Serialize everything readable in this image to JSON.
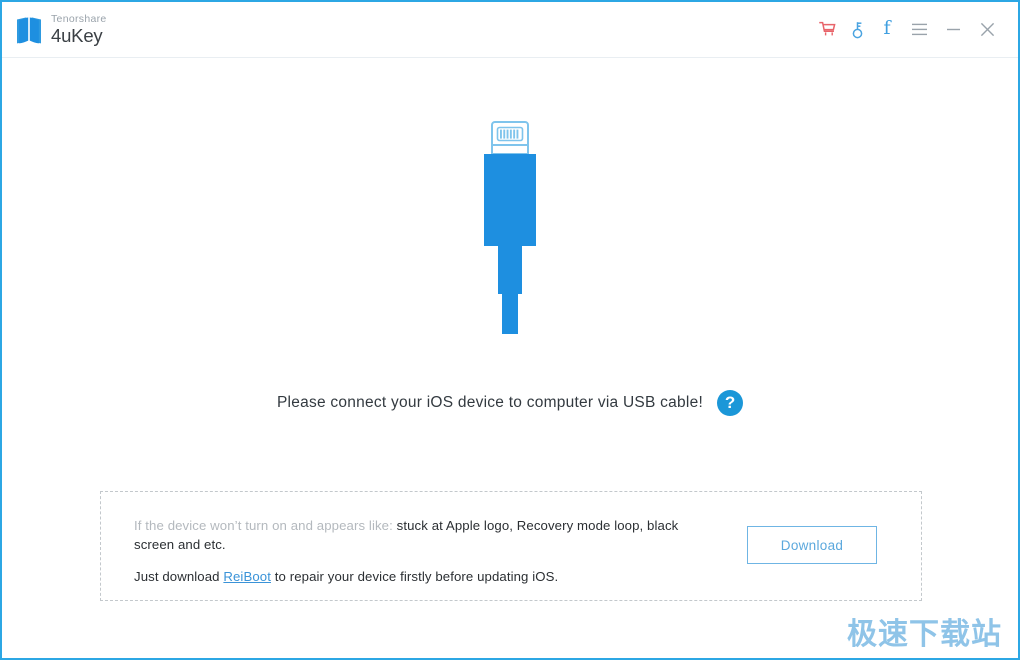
{
  "window": {
    "accent_border_color": "#2ca7e4",
    "background": "#ffffff"
  },
  "titlebar": {
    "brand_top": "Tenorshare",
    "brand_bottom": "4uKey",
    "logo_icon": "shield-book-logo",
    "icons": [
      {
        "name": "cart-icon",
        "label": "Store",
        "color": "#e8646a"
      },
      {
        "name": "key-icon",
        "label": "Register",
        "color": "#4aa3e0"
      },
      {
        "name": "facebook-icon",
        "label": "Facebook",
        "color": "#3f9fe0",
        "glyph": "f"
      },
      {
        "name": "menu-icon",
        "label": "Menu",
        "color": "#9aa3ab"
      },
      {
        "name": "minimize-icon",
        "label": "Minimize",
        "color": "#9aa3ab"
      },
      {
        "name": "close-icon",
        "label": "Close",
        "color": "#9aa3ab"
      }
    ]
  },
  "main": {
    "illustration_name": "lightning-usb-cable-illustration",
    "illustration_colors": {
      "body": "#1e8fe0",
      "tip_stroke": "#7fc4ec",
      "tip_fill": "#ffffff",
      "pin_color": "#7fc4ec"
    },
    "connect_message": "Please connect your iOS device to computer via USB cable!",
    "help_badge": {
      "name": "help-icon",
      "glyph": "?",
      "color": "#1b97d8"
    }
  },
  "hint_panel": {
    "line1_lead": "If the device won’t turn on and appears like:",
    "line1_rest": "stuck at Apple logo, Recovery mode loop, black screen and etc.",
    "line2_prefix": "Just download",
    "line2_link": "ReiBoot",
    "line2_suffix": "to repair your device firstly before updating iOS.",
    "download_label": "Download",
    "border_style": "dashed",
    "border_color": "#c3c8cc"
  },
  "watermark": {
    "text": "极速下载站",
    "color": "#8fc4e8"
  }
}
